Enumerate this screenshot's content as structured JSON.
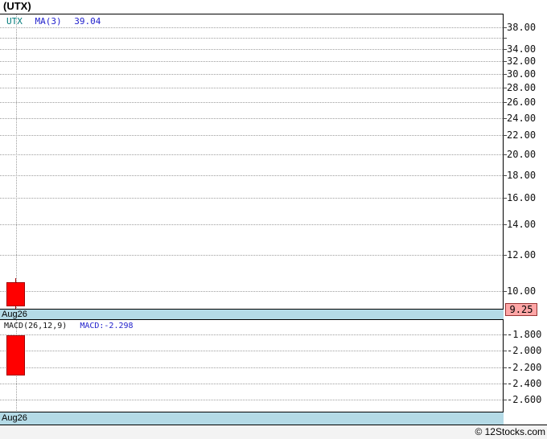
{
  "page_title": "(UTX)",
  "main_panel": {
    "legend": {
      "symbol": "UTX",
      "ma": "MA(3)",
      "ma_value": "39.04"
    },
    "date_label": "Aug26",
    "last_price": "9.25"
  },
  "macd_panel": {
    "legend_label": "MACD(26,12,9)",
    "legend_value": "MACD:-2.298",
    "date_label": "Aug26"
  },
  "footer": {
    "credit": "© 12Stocks.com"
  },
  "colors": {
    "symbol": "#007a7a",
    "indicator_value": "#2222cc",
    "candle_fill": "#ff0000",
    "candle_border": "#a40000",
    "band_fill": "#b4dae6",
    "last_price_fill": "#ffa6a6",
    "last_price_border": "#993333",
    "grid": "#9e9e9e"
  },
  "chart_data": [
    {
      "type": "candlestick",
      "title": "(UTX)",
      "symbol": "UTX",
      "x": [
        "Aug26"
      ],
      "series": [
        {
          "name": "UTX",
          "ohlc": [
            {
              "open": 10.45,
              "high": 10.65,
              "low": 9.1,
              "close": 9.25
            }
          ],
          "direction": [
            "down"
          ]
        }
      ],
      "overlays": [
        {
          "name": "MA(3)",
          "last_value": 39.04
        }
      ],
      "last_price": 9.25,
      "yscale": "log",
      "ylim": [
        9.18,
        40.7
      ],
      "yticks_labeled": [
        38,
        34,
        32,
        30,
        28,
        26,
        24,
        22,
        20,
        18,
        16,
        14,
        12,
        10
      ],
      "yticks_unlabeled": [
        36
      ],
      "grid": true,
      "legend_position": "top-left"
    },
    {
      "type": "bar",
      "title": "MACD(26,12,9)",
      "x": [
        "Aug26"
      ],
      "series": [
        {
          "name": "MACD",
          "values": [
            -2.298
          ]
        }
      ],
      "bar_draw_from": -1.81,
      "ylim": [
        -2.736,
        -1.623
      ],
      "yticks": [
        -1.8,
        -2.0,
        -2.2,
        -2.4,
        -2.6
      ],
      "grid": true
    }
  ]
}
